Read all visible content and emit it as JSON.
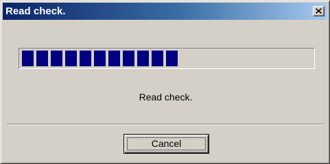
{
  "window": {
    "title": "Read check.",
    "close_icon": "close-icon"
  },
  "progress": {
    "filled_blocks": 11,
    "fraction": 0.5,
    "fill_color": "#000080"
  },
  "status": {
    "message": "Read check."
  },
  "buttons": {
    "cancel_label": "Cancel"
  },
  "colors": {
    "titlebar_start": "#0a246a",
    "titlebar_end": "#a6caf0",
    "dialog_face": "#d4d0c8"
  }
}
